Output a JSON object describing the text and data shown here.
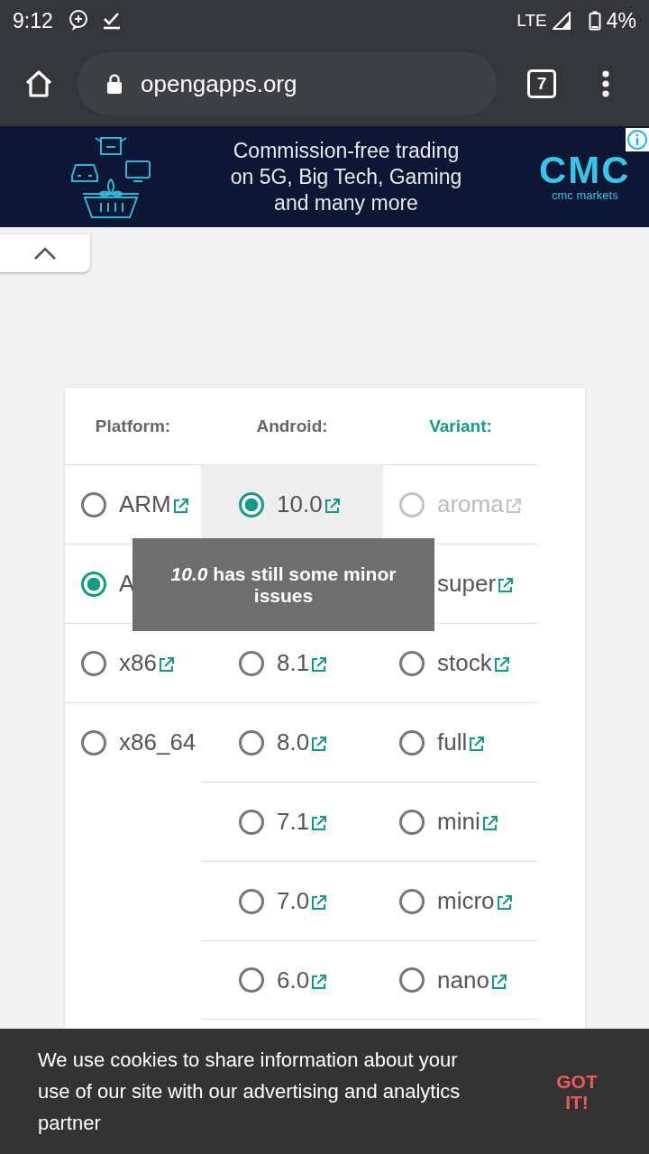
{
  "status_bar": {
    "time": "9:12",
    "network": "LTE",
    "battery": "4%"
  },
  "browser": {
    "url": "opengapps.org",
    "tab_count": "7"
  },
  "ad": {
    "lines": [
      "Commission-free trading",
      "on 5G, Big Tech, Gaming",
      "and many more"
    ],
    "logo": "CMC",
    "logo_caption": "cmc markets"
  },
  "columns": [
    {
      "heading": "Platform:",
      "highlighted": false,
      "options": [
        {
          "label": "ARM",
          "selected": false,
          "disabled": false,
          "link": true
        },
        {
          "label": "A",
          "selected": true,
          "disabled": false
        },
        {
          "label": "x86",
          "selected": false,
          "disabled": false,
          "link": true
        },
        {
          "label": "x86_64",
          "selected": false,
          "disabled": false
        }
      ]
    },
    {
      "heading": "Android:",
      "highlighted": false,
      "options": [
        {
          "label": "10.0",
          "selected": true,
          "disabled": false,
          "link": true
        },
        {
          "label": "8.1",
          "selected": false,
          "disabled": false,
          "link": true
        },
        {
          "label": "8.0",
          "selected": false,
          "disabled": false,
          "link": true
        },
        {
          "label": "7.1",
          "selected": false,
          "disabled": false,
          "link": true
        },
        {
          "label": "7.0",
          "selected": false,
          "disabled": false,
          "link": true
        },
        {
          "label": "6.0",
          "selected": false,
          "disabled": false,
          "link": true
        }
      ]
    },
    {
      "heading": "Variant:",
      "highlighted": true,
      "options": [
        {
          "label": "aroma",
          "selected": false,
          "disabled": true,
          "link": true
        },
        {
          "label": "super",
          "link": true
        },
        {
          "label": "stock",
          "selected": false,
          "disabled": false,
          "link": true
        },
        {
          "label": "full",
          "selected": false,
          "disabled": false,
          "link": true
        },
        {
          "label": "mini",
          "selected": false,
          "disabled": false,
          "link": true
        },
        {
          "label": "micro",
          "selected": false,
          "disabled": false,
          "link": true
        },
        {
          "label": "nano",
          "selected": false,
          "disabled": false,
          "link": true
        }
      ]
    }
  ],
  "tooltip": "*10.0* has still some minor issues",
  "cookie_bar": {
    "text": "We use cookies to share information about your use of our site with our advertising and analytics partner",
    "button": "GOT IT!"
  }
}
